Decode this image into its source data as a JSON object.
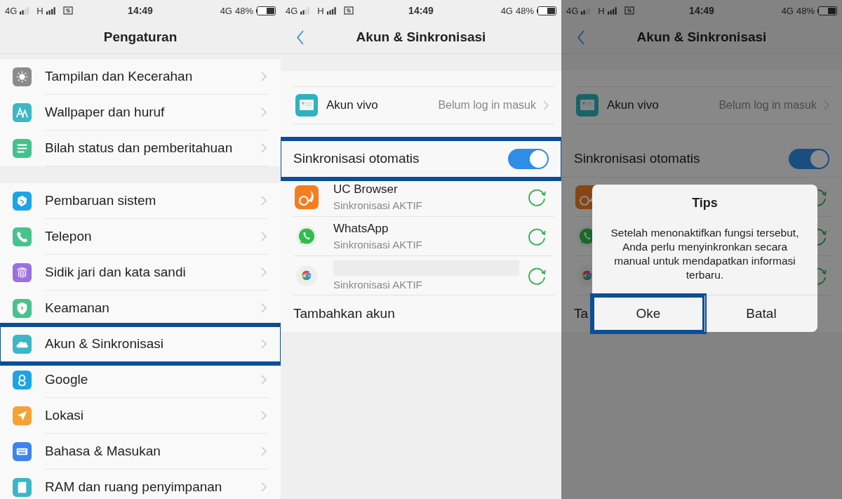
{
  "settings_screen": {
    "status": {
      "network_1": "4G",
      "network_2": "H",
      "time": "14:49",
      "network_3": "4G",
      "battery": "48%"
    },
    "title": "Pengaturan",
    "groups": [
      {
        "items": [
          {
            "label": "Tampilan dan Kecerahan",
            "kind": "display",
            "color": "#8c8c8c",
            "highlighted": false
          },
          {
            "label": "Wallpaper dan huruf",
            "kind": "wallpaper",
            "color": "#3db6c6",
            "highlighted": false
          },
          {
            "label": "Bilah status dan pemberitahuan",
            "kind": "statusbar",
            "color": "#45c18b",
            "highlighted": false
          }
        ]
      },
      {
        "items": [
          {
            "label": "Pembaruan sistem",
            "kind": "update",
            "color": "#1ca4e6",
            "highlighted": false
          },
          {
            "label": "Telepon",
            "kind": "phone",
            "color": "#48c38d",
            "highlighted": false
          },
          {
            "label": "Sidik jari dan kata sandi",
            "kind": "fingerprint",
            "color": "#9b6fe0",
            "highlighted": false
          },
          {
            "label": "Keamanan",
            "kind": "security",
            "color": "#48c38d",
            "highlighted": false
          },
          {
            "label": "Akun & Sinkronisasi",
            "kind": "account",
            "color": "#3db6c6",
            "highlighted": true
          },
          {
            "label": "Google",
            "kind": "google",
            "color": "#1ca4e6",
            "highlighted": false
          },
          {
            "label": "Lokasi",
            "kind": "location",
            "color": "#f5a136",
            "highlighted": false
          },
          {
            "label": "Bahasa & Masukan",
            "kind": "language",
            "color": "#3f83ec",
            "highlighted": false
          },
          {
            "label": "RAM dan ruang penyimpanan",
            "kind": "storage",
            "color": "#3db6c6",
            "highlighted": false
          }
        ]
      }
    ]
  },
  "accounts_screen": {
    "status": {
      "network_1": "4G",
      "network_2": "H",
      "time": "14:49",
      "network_3": "4G",
      "battery": "48%"
    },
    "title": "Akun & Sinkronisasi",
    "vivo_account": {
      "label": "Akun vivo",
      "value": "Belum log in masuk"
    },
    "auto_sync": {
      "label": "Sinkronisasi otomatis",
      "on": true,
      "highlighted": true
    },
    "apps": [
      {
        "kind": "uc",
        "name": "UC Browser",
        "status": "Sinkronisasi AKTIF"
      },
      {
        "kind": "whatsapp",
        "name": "WhatsApp",
        "status": "Sinkronisasi AKTIF"
      },
      {
        "kind": "google",
        "status": "Sinkronisasi AKTIF",
        "redacted": true
      }
    ],
    "add_account": "Tambahkan akun"
  },
  "dialog_screen": {
    "status": {
      "network_1": "4G",
      "network_2": "H",
      "time": "14:49",
      "network_3": "4G",
      "battery": "48%"
    },
    "title": "Akun & Sinkronisasi",
    "vivo_account": {
      "label": "Akun vivo",
      "value": "Belum log in masuk"
    },
    "auto_sync": {
      "label": "Sinkronisasi otomatis",
      "on": true,
      "highlighted": false
    },
    "apps": [
      {
        "kind": "uc"
      },
      {
        "kind": "whatsapp"
      },
      {
        "kind": "google"
      }
    ],
    "add_account": "Ta",
    "dialog": {
      "title": "Tips",
      "message": "Setelah menonaktifkan fungsi tersebut, Anda perlu menyinkronkan secara manual untuk mendapatkan informasi terbaru.",
      "buttons": [
        {
          "label": "Oke",
          "highlighted": true
        },
        {
          "label": "Batal",
          "highlighted": false
        }
      ]
    }
  }
}
